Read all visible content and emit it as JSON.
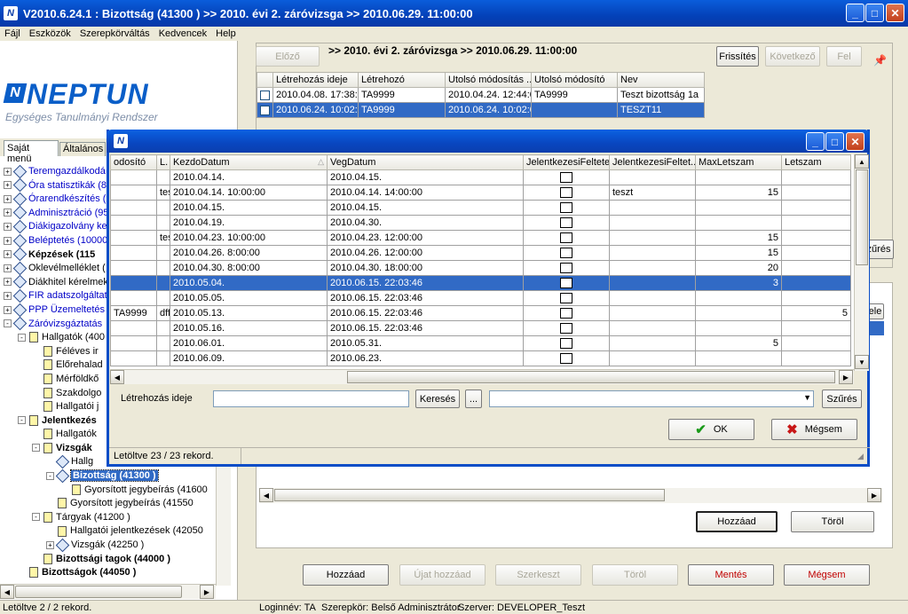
{
  "window": {
    "title": "V2010.6.24.1 : Bizottság (41300  )  >> 2010. évi 2. záróvizsga  >> 2010.06.29. 11:00:00"
  },
  "menu": [
    "Fájl",
    "Eszközök",
    "Szerepkörváltás",
    "Kedvencek",
    "Help"
  ],
  "logo": {
    "text": "NEPTUN",
    "subtitle": "Egységes Tanulmányi Rendszer"
  },
  "sidebar": {
    "tabs": [
      "Saját menü",
      "Általános m"
    ],
    "tree": [
      {
        "text": "Teremgazdálkodá",
        "level": 0,
        "pm": "+",
        "icon": "diam",
        "cls": "blue"
      },
      {
        "text": "Óra statisztikák (8",
        "level": 0,
        "pm": "+",
        "icon": "diam",
        "cls": "blue"
      },
      {
        "text": "Órarendkészítés (",
        "level": 0,
        "pm": "+",
        "icon": "diam",
        "cls": "blue"
      },
      {
        "text": "Adminisztráció (95",
        "level": 0,
        "pm": "+",
        "icon": "diam",
        "cls": "blue"
      },
      {
        "text": "Diákigazolvány ke",
        "level": 0,
        "pm": "+",
        "icon": "diam",
        "cls": "blue"
      },
      {
        "text": "Beléptetés (10000",
        "level": 0,
        "pm": "+",
        "icon": "diam",
        "cls": "blue"
      },
      {
        "text": "Képzések (115",
        "level": 0,
        "pm": "+",
        "icon": "diam",
        "cls": "bold"
      },
      {
        "text": "Oklevélmelléklet (",
        "level": 0,
        "pm": "+",
        "icon": "diam",
        "cls": ""
      },
      {
        "text": "Diákhitel kérelmek",
        "level": 0,
        "pm": "+",
        "icon": "diam",
        "cls": ""
      },
      {
        "text": "FIR adatszolgáltat",
        "level": 0,
        "pm": "+",
        "icon": "diam",
        "cls": "blue"
      },
      {
        "text": "PPP Üzemeltetés",
        "level": 0,
        "pm": "+",
        "icon": "diam",
        "cls": "blue"
      },
      {
        "text": "Záróvizsgáztatás",
        "level": 0,
        "pm": "-",
        "icon": "diam",
        "cls": "blue"
      },
      {
        "text": "Hallgatók (400",
        "level": 1,
        "pm": "-",
        "icon": "page",
        "cls": ""
      },
      {
        "text": "Féléves ir",
        "level": 2,
        "pm": "",
        "icon": "page",
        "cls": ""
      },
      {
        "text": "Előrehalad",
        "level": 2,
        "pm": "",
        "icon": "page",
        "cls": ""
      },
      {
        "text": "Mérföldkő",
        "level": 2,
        "pm": "",
        "icon": "page",
        "cls": ""
      },
      {
        "text": "Szakdolgo",
        "level": 2,
        "pm": "",
        "icon": "page",
        "cls": ""
      },
      {
        "text": "Hallgatói j",
        "level": 2,
        "pm": "",
        "icon": "page",
        "cls": ""
      },
      {
        "text": "Jelentkezés",
        "level": 1,
        "pm": "-",
        "icon": "page",
        "cls": "bold"
      },
      {
        "text": "Hallgatók",
        "level": 2,
        "pm": "",
        "icon": "page",
        "cls": ""
      },
      {
        "text": "Vizsgák",
        "level": 2,
        "pm": "-",
        "icon": "page",
        "cls": "bold"
      },
      {
        "text": "Hallg",
        "level": 3,
        "pm": "",
        "icon": "diam",
        "cls": ""
      },
      {
        "text": "Bizottság (41300  )",
        "level": 3,
        "pm": "-",
        "icon": "diam",
        "cls": "bold",
        "selected": true
      },
      {
        "text": "Gyorsított jegybeírás (41600",
        "level": 4,
        "pm": "",
        "icon": "page",
        "cls": ""
      },
      {
        "text": "Gyorsított jegybeírás (41550",
        "level": 3,
        "pm": "",
        "icon": "page",
        "cls": ""
      },
      {
        "text": "Tárgyak (41200 )",
        "level": 2,
        "pm": "-",
        "icon": "page",
        "cls": ""
      },
      {
        "text": "Hallgatói jelentkezések (42050",
        "level": 3,
        "pm": "",
        "icon": "page",
        "cls": ""
      },
      {
        "text": "Vizsgák (42250 )",
        "level": 3,
        "pm": "+",
        "icon": "diam",
        "cls": ""
      },
      {
        "text": "Bizottsági tagok (44000 )",
        "level": 2,
        "pm": "",
        "icon": "page",
        "cls": "bold"
      },
      {
        "text": "Bizottságok (44050 )",
        "level": 1,
        "pm": "",
        "icon": "page",
        "cls": "bold"
      }
    ]
  },
  "main": {
    "breadcrumb": ">> 2010. évi 2. záróvizsga  >> 2010.06.29. 11:00:00",
    "buttons": {
      "prev": "Előző",
      "refresh": "Frissítés",
      "next": "Következő",
      "up": "Fel"
    },
    "grid": {
      "headers": [
        "",
        "Létrehozás ideje",
        "Létrehozó",
        "Utolsó módosítás ...",
        "Utolsó módosító",
        "Nev"
      ],
      "rows": [
        [
          "",
          "2010.04.08. 17:38:4",
          "TA9999",
          "2010.04.24. 12:44:0",
          "TA9999",
          "Teszt bizottság 1a"
        ],
        [
          "",
          "2010.06.24. 10:02:0",
          "TA9999",
          "2010.06.24. 10:02:0",
          "",
          "TESZT11"
        ]
      ]
    },
    "side_filter_btn": "zűrés",
    "side_btn_ele": "ele",
    "lower_buttons": {
      "add": "Hozzáad",
      "delete": "Töröl"
    },
    "bottom_buttons": [
      "Hozzáad",
      "Újat hozzáad",
      "Szerkeszt",
      "Töröl",
      "Mentés",
      "Mégsem"
    ]
  },
  "dialog": {
    "headers": [
      "odosító",
      "L.",
      "KezdoDatum",
      "VegDatum",
      "JelentkezesiFeltetel",
      "JelentkezesiFeltet...",
      "MaxLetszam",
      "Letszam"
    ],
    "rows": [
      [
        "",
        "",
        "2010.04.14.",
        "2010.04.15.",
        "",
        "",
        "",
        ""
      ],
      [
        "",
        "tes",
        "2010.04.14. 10:00:00",
        "2010.04.14. 14:00:00",
        "",
        "teszt",
        "15",
        ""
      ],
      [
        "",
        "",
        "2010.04.15.",
        "2010.04.15.",
        "",
        "",
        "",
        ""
      ],
      [
        "",
        "",
        "2010.04.19.",
        "2010.04.30.",
        "",
        "",
        "",
        ""
      ],
      [
        "",
        "tes",
        "2010.04.23. 10:00:00",
        "2010.04.23. 12:00:00",
        "",
        "",
        "15",
        ""
      ],
      [
        "",
        "",
        "2010.04.26. 8:00:00",
        "2010.04.26. 12:00:00",
        "",
        "",
        "15",
        ""
      ],
      [
        "",
        "",
        "2010.04.30. 8:00:00",
        "2010.04.30. 18:00:00",
        "",
        "",
        "20",
        ""
      ],
      [
        "",
        "",
        "2010.05.04.",
        "2010.06.15. 22:03:46",
        "",
        "",
        "3",
        ""
      ],
      [
        "",
        "",
        "2010.05.05.",
        "2010.06.15. 22:03:46",
        "",
        "",
        "",
        ""
      ],
      [
        "TA9999",
        "dff",
        "2010.05.13.",
        "2010.06.15. 22:03:46",
        "",
        "",
        "",
        "5"
      ],
      [
        "",
        "",
        "2010.05.16.",
        "2010.06.15. 22:03:46",
        "",
        "",
        "",
        ""
      ],
      [
        "",
        "",
        "2010.06.01.",
        "2010.05.31.",
        "",
        "",
        "5",
        ""
      ],
      [
        "",
        "",
        "2010.06.09.",
        "2010.06.23.",
        "",
        "",
        "",
        ""
      ]
    ],
    "selected_row": 7,
    "filter_label": "Létrehozás ideje",
    "search_btn": "Keresés",
    "dots_btn": "...",
    "filter_btn": "Szűrés",
    "ok": "OK",
    "cancel": "Mégsem",
    "status": "Letöltve 23 / 23 rekord."
  },
  "statusbar": {
    "left": "Letöltve 2 / 2 rekord.",
    "login": "Loginnév: TA",
    "role": "Szerepkör: Belső Adminisztrátor",
    "server": "Szerver: DEVELOPER_Teszt"
  }
}
